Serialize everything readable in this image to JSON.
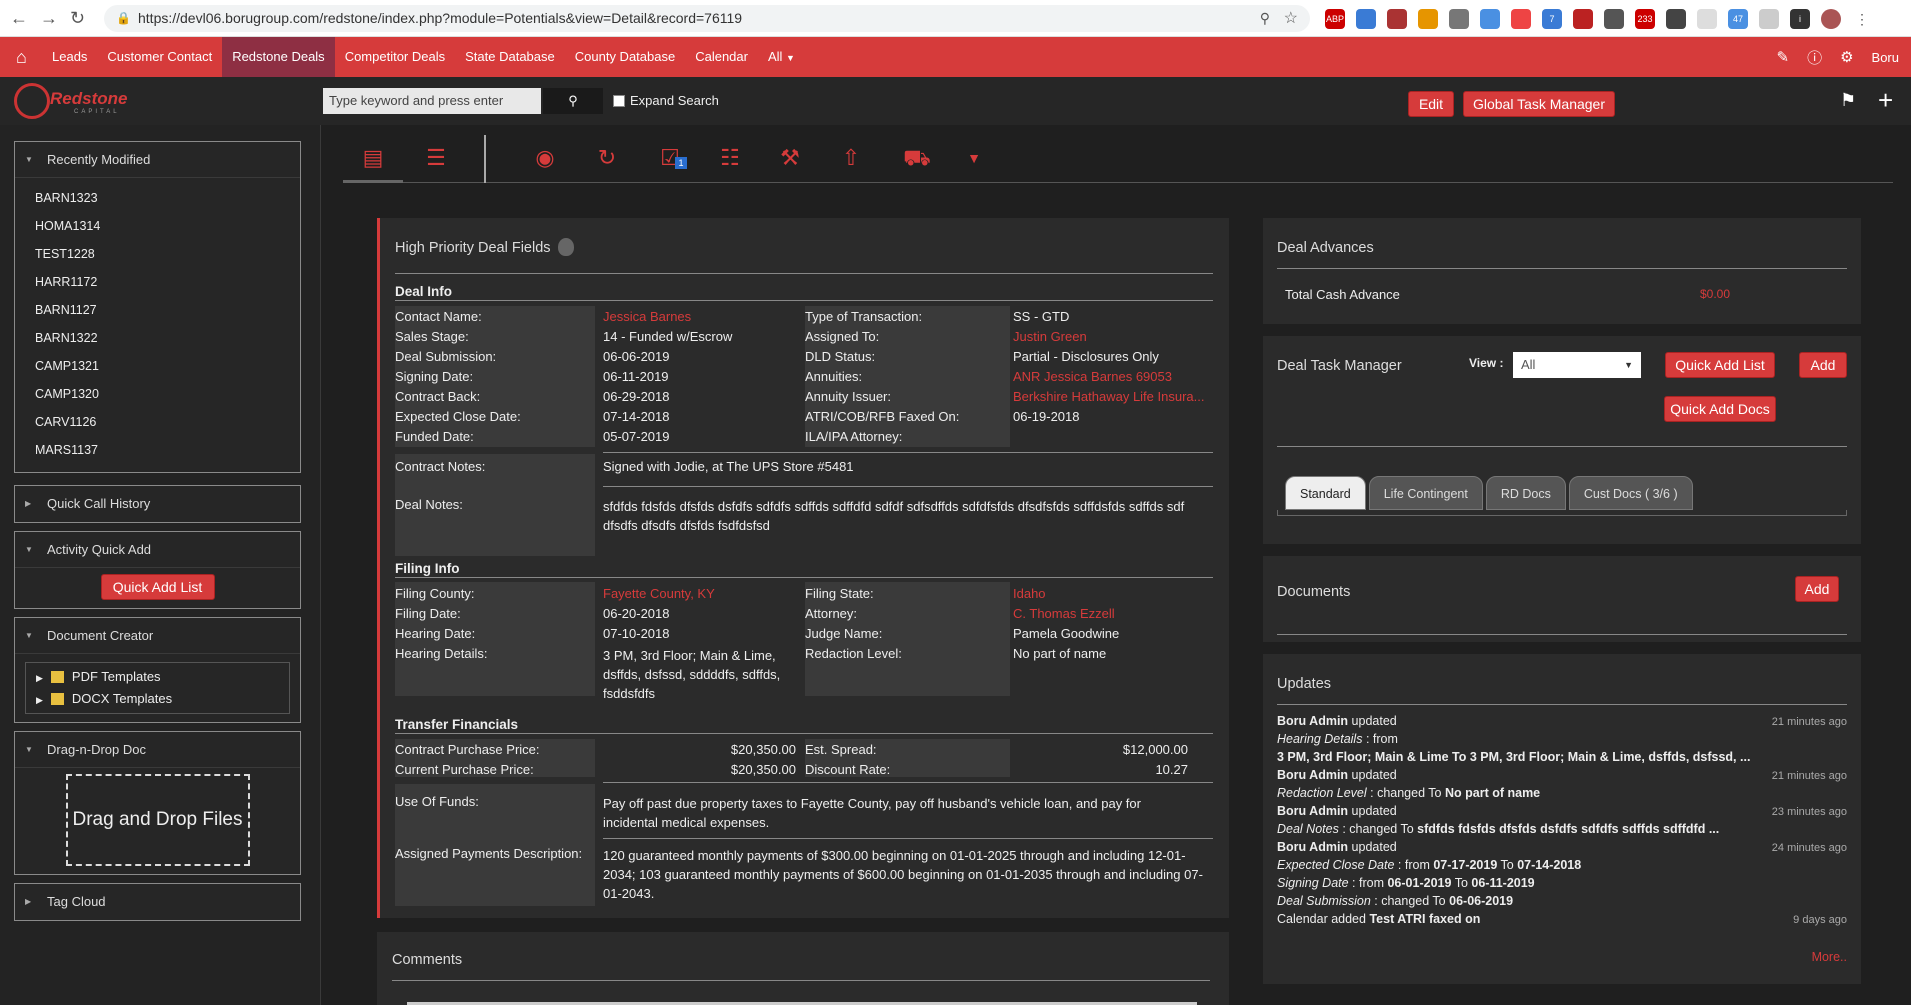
{
  "browser": {
    "url": "https://devl06.borugroup.com/redstone/index.php?module=Potentials&view=Detail&record=76119",
    "ext_badges": [
      "ABP",
      "7",
      "233",
      "47"
    ]
  },
  "nav": {
    "items": [
      "Leads",
      "Customer Contact",
      "Redstone Deals",
      "Competitor Deals",
      "State Database",
      "County Database",
      "Calendar",
      "All"
    ],
    "user": "Boru"
  },
  "header": {
    "logo_text": "Redstone",
    "logo_sub": "CAPITAL",
    "search_placeholder": "Type keyword and press enter",
    "expand_search": "Expand Search",
    "edit": "Edit",
    "global_task_manager": "Global Task Manager"
  },
  "sidebar": {
    "recently_modified_title": "Recently Modified",
    "recently_modified": [
      "BARN1323",
      "HOMA1314",
      "TEST1228",
      "HARR1172",
      "BARN1127",
      "BARN1322",
      "CAMP1321",
      "CAMP1320",
      "CARV1126",
      "MARS1137"
    ],
    "quick_call_history": "Quick Call History",
    "activity_quick_add": "Activity Quick Add",
    "quick_add_list": "Quick Add List",
    "document_creator": "Document Creator",
    "pdf_templates": "PDF Templates",
    "docx_templates": "DOCX Templates",
    "drag_n_drop": "Drag-n-Drop Doc",
    "drag_and_drop_files": "Drag and Drop Files",
    "tag_cloud": "Tag Cloud"
  },
  "toolbar": {
    "task_badge": "1"
  },
  "deal": {
    "title": "High Priority Deal Fields",
    "deal_info": "Deal Info",
    "left_fields": [
      {
        "label": "Contact Name:",
        "value": "Jessica Barnes"
      },
      {
        "label": "Sales Stage:",
        "value": "14 - Funded w/Escrow"
      },
      {
        "label": "Deal Submission:",
        "value": "06-06-2019"
      },
      {
        "label": "Signing Date:",
        "value": "06-11-2019"
      },
      {
        "label": "Contract Back:",
        "value": "06-29-2018"
      },
      {
        "label": "Expected Close Date:",
        "value": "07-14-2018"
      },
      {
        "label": "Funded Date:",
        "value": "05-07-2019"
      }
    ],
    "right_fields": [
      {
        "label": "Type of Transaction:",
        "value": "SS - GTD"
      },
      {
        "label": "Assigned To:",
        "value": "Justin Green"
      },
      {
        "label": "DLD Status:",
        "value": "Partial - Disclosures Only"
      },
      {
        "label": "Annuities:",
        "value": "ANR Jessica Barnes 69053"
      },
      {
        "label": "Annuity Issuer:",
        "value": "Berkshire Hathaway Life Insura..."
      },
      {
        "label": "ATRI/COB/RFB Faxed On:",
        "value": "06-19-2018"
      },
      {
        "label": "ILA/IPA Attorney:",
        "value": ""
      }
    ],
    "contract_notes_label": "Contract Notes:",
    "contract_notes": "Signed with Jodie, at The UPS Store #5481",
    "deal_notes_label": "Deal Notes:",
    "deal_notes": "sfdfds fdsfds dfsfds dsfdfs sdfdfs sdffds sdffdfd sdfdf sdfsdffds sdfdfsfds dfsdfsfds sdffdsfds sdffds sdf dfsdfs dfsdfs dfsfds fsdfdsfsd",
    "filing_info": "Filing Info",
    "filing_left": [
      {
        "label": "Filing County:",
        "value": "Fayette County, KY"
      },
      {
        "label": "Filing Date:",
        "value": "06-20-2018"
      },
      {
        "label": "Hearing Date:",
        "value": "07-10-2018"
      },
      {
        "label": "Hearing Details:",
        "value": "3 PM, 3rd Floor; Main & Lime, dsffds, dsfssd, sddddfs, sdffds, fsddsfdfs"
      }
    ],
    "filing_right": [
      {
        "label": "Filing State:",
        "value": "Idaho"
      },
      {
        "label": "Attorney:",
        "value": "C. Thomas Ezzell"
      },
      {
        "label": "Judge Name:",
        "value": "Pamela Goodwine"
      },
      {
        "label": "Redaction Level:",
        "value": "No part of name"
      }
    ],
    "transfer_financials": "Transfer Financials",
    "cpp_label": "Contract Purchase Price:",
    "cpp": "$20,350.00",
    "curpp_label": "Current Purchase Price:",
    "curpp": "$20,350.00",
    "spread_label": "Est. Spread:",
    "spread": "$12,000.00",
    "discount_label": "Discount Rate:",
    "discount": "10.27",
    "use_funds_label": "Use Of Funds:",
    "use_funds": "Pay off past due property taxes to Fayette County, pay off husband's vehicle loan, and pay for incidental medical expenses.",
    "apd_label": "Assigned Payments Description:",
    "apd": "120 guaranteed monthly payments of $300.00 beginning on 01-01-2025 through and including 12-01-2034; 103 guaranteed monthly payments of $600.00 beginning on 01-01-2035 through and including 07-01-2043."
  },
  "comments": "Comments",
  "advances": {
    "title": "Deal Advances",
    "label": "Total Cash Advance",
    "value": "$0.00"
  },
  "task_manager": {
    "title": "Deal Task Manager",
    "view_label": "View :",
    "view_value": "All",
    "quick_add_list": "Quick Add List",
    "add": "Add",
    "quick_add_docs": "Quick Add Docs",
    "tabs": [
      "Standard",
      "Life Contingent",
      "RD Docs",
      "Cust Docs ( 3/6 )"
    ]
  },
  "documents": {
    "title": "Documents",
    "add": "Add"
  },
  "updates": {
    "title": "Updates",
    "more": "More..",
    "lines": [
      {
        "user": "Boru Admin",
        "action": "updated",
        "ago": "21 minutes ago"
      },
      {
        "field": "Hearing Details",
        "text": "from"
      },
      {
        "bold": "3 PM, 3rd Floor; Main & Lime To 3 PM, 3rd Floor; Main & Lime, dsffds, dsfssd, ..."
      },
      {
        "user": "Boru Admin",
        "action": "updated",
        "ago": "21 minutes ago"
      },
      {
        "field": "Redaction Level",
        "text": "changed To",
        "bold": "No part of name"
      },
      {
        "user": "Boru Admin",
        "action": "updated",
        "ago": "23 minutes ago"
      },
      {
        "field": "Deal Notes",
        "text": "changed To",
        "bold": "sfdfds fdsfds dfsfds dsfdfs sdfdfs sdffds sdffdfd ..."
      },
      {
        "user": "Boru Admin",
        "action": "updated",
        "ago": "24 minutes ago"
      },
      {
        "field": "Expected Close Date",
        "text": "from",
        "bold": "07-17-2019",
        "to": "To",
        "bold2": "07-14-2018"
      },
      {
        "field": "Signing Date",
        "text": "from",
        "bold": "06-01-2019",
        "to": "To",
        "bold2": "06-11-2019"
      },
      {
        "field": "Deal Submission",
        "text": "changed To",
        "bold": "06-06-2019"
      },
      {
        "text": "Calendar added",
        "bold": "Test ATRI faxed on",
        "ago": "9 days ago"
      }
    ]
  }
}
